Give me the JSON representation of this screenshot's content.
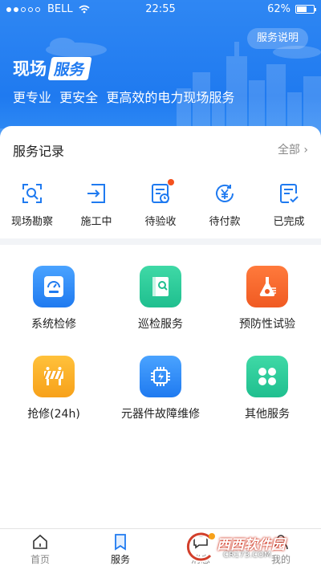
{
  "status_bar": {
    "carrier": "BELL",
    "time": "22:55",
    "battery": "62%",
    "battery_level": 0.62
  },
  "header": {
    "help_button": "服务说明",
    "brand_part1": "现场",
    "brand_part2": "服务",
    "slogan": "更专业  更安全  更高效的电力现场服务"
  },
  "records": {
    "title": "服务记录",
    "all_label": "全部",
    "items": [
      {
        "label": "现场勘察",
        "icon": "survey-icon"
      },
      {
        "label": "施工中",
        "icon": "construction-icon"
      },
      {
        "label": "待验收",
        "icon": "pending-acceptance-icon",
        "badge": true
      },
      {
        "label": "待付款",
        "icon": "payment-icon"
      },
      {
        "label": "已完成",
        "icon": "completed-icon"
      }
    ]
  },
  "services": [
    {
      "label": "系统检修",
      "icon": "meter-icon",
      "color": "#2b8af5"
    },
    {
      "label": "巡检服务",
      "icon": "inspection-book-icon",
      "color": "#1fbf8f"
    },
    {
      "label": "预防性试验",
      "icon": "flask-icon",
      "color": "#f05a22"
    },
    {
      "label": "抢修(24h)",
      "icon": "barrier-icon",
      "color": "#f7a11a"
    },
    {
      "label": "元器件故障维修",
      "icon": "chip-icon",
      "color": "#2b8af5"
    },
    {
      "label": "其他服务",
      "icon": "more-services-icon",
      "color": "#1fbf8f"
    }
  ],
  "tabbar": {
    "items": [
      {
        "label": "首页",
        "icon": "home-icon"
      },
      {
        "label": "服务",
        "icon": "bookmark-icon",
        "active": true
      },
      {
        "label": "消息",
        "icon": "message-icon"
      },
      {
        "label": "我的",
        "icon": "profile-icon"
      }
    ]
  },
  "watermark": {
    "name": "西西软件园",
    "url": "CR173.COM"
  },
  "colors": {
    "primary": "#1f7af0",
    "badge": "#f4511e"
  }
}
